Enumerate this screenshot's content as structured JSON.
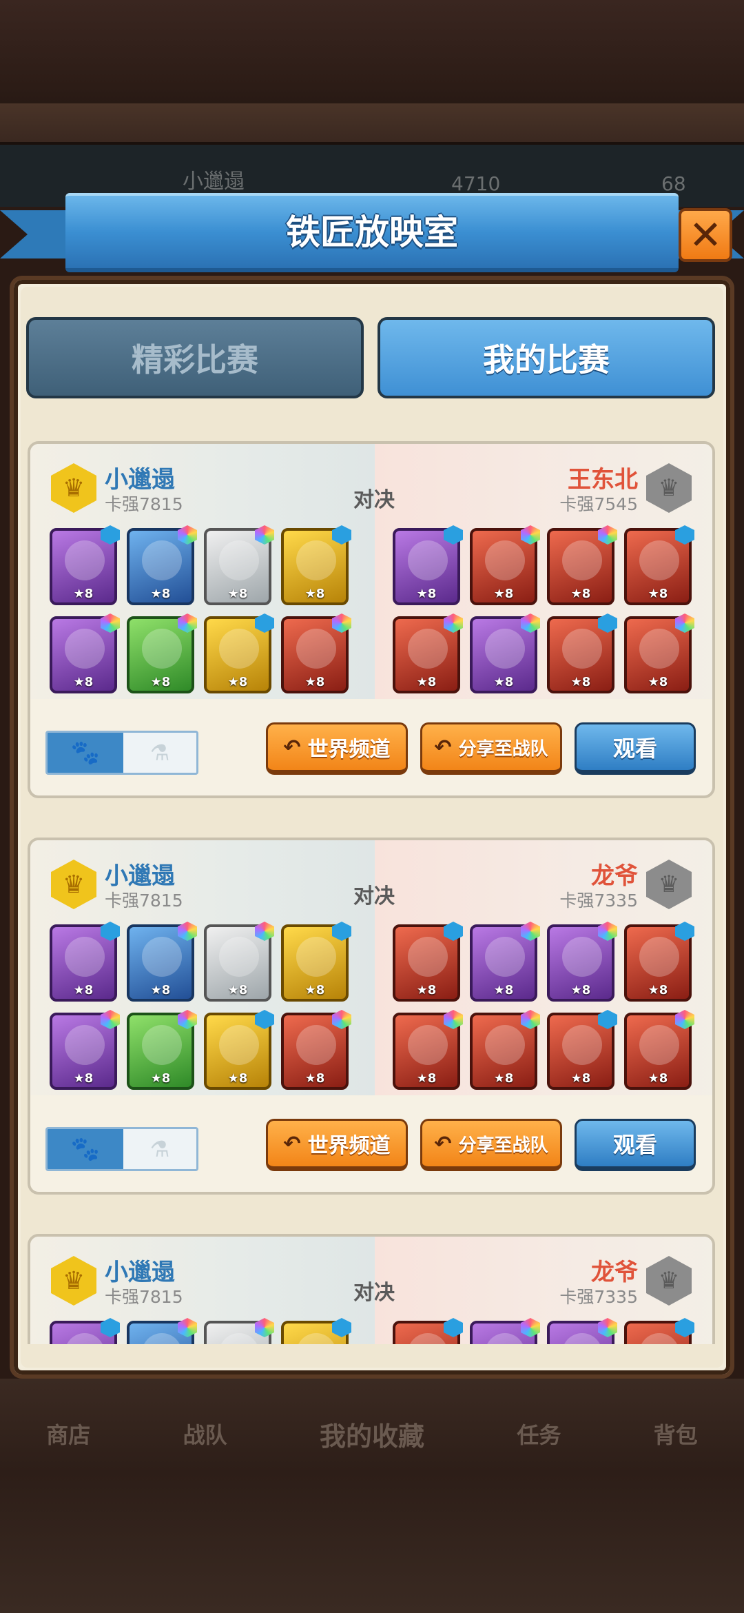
{
  "background": {
    "hud_name": "小邋遢",
    "hud_value_1": "4710",
    "hud_value_2": "68",
    "nav": [
      "商店",
      "战队",
      "我的收藏",
      "任务",
      "背包"
    ]
  },
  "dialog": {
    "title": "铁匠放映室",
    "close_icon": "close-x",
    "tabs": [
      {
        "label": "精彩比赛",
        "active": false
      },
      {
        "label": "我的比赛",
        "active": true
      }
    ]
  },
  "common": {
    "vs_label": "对决",
    "world_channel_label": "世界频道",
    "share_team_label": "分享至战队",
    "watch_label": "观看",
    "star_level": "★8"
  },
  "matches": [
    {
      "left": {
        "name": "小邋遢",
        "power": "卡强7815",
        "badge": "gold-crown"
      },
      "right": {
        "name": "王东北",
        "power": "卡强7545",
        "badge": "gray-rank"
      },
      "left_heroes": [
        "purple",
        "blue",
        "white",
        "gold",
        "purple",
        "green",
        "gold",
        "red"
      ],
      "right_heroes": [
        "purple",
        "red",
        "red",
        "red",
        "red",
        "purple",
        "red",
        "red"
      ]
    },
    {
      "left": {
        "name": "小邋遢",
        "power": "卡强7815",
        "badge": "gold-crown"
      },
      "right": {
        "name": "龙爷",
        "power": "卡强7335",
        "badge": "gray-rank"
      },
      "left_heroes": [
        "purple",
        "blue",
        "white",
        "gold",
        "purple",
        "green",
        "gold",
        "red"
      ],
      "right_heroes": [
        "red",
        "purple",
        "purple",
        "red",
        "red",
        "red",
        "red",
        "red"
      ]
    },
    {
      "left": {
        "name": "小邋遢",
        "power": "卡强7815",
        "badge": "gold-crown"
      },
      "right": {
        "name": "龙爷",
        "power": "卡强7335",
        "badge": "gray-rank"
      },
      "left_heroes": [
        "purple",
        "blue",
        "white",
        "gold"
      ],
      "right_heroes": [
        "red",
        "purple",
        "purple",
        "red"
      ]
    }
  ],
  "colors": {
    "ribbon_blue": "#3b8fd2",
    "orange_button": "#f28518",
    "left_player_name": "#2f78b5",
    "right_player_name": "#e0533a"
  }
}
